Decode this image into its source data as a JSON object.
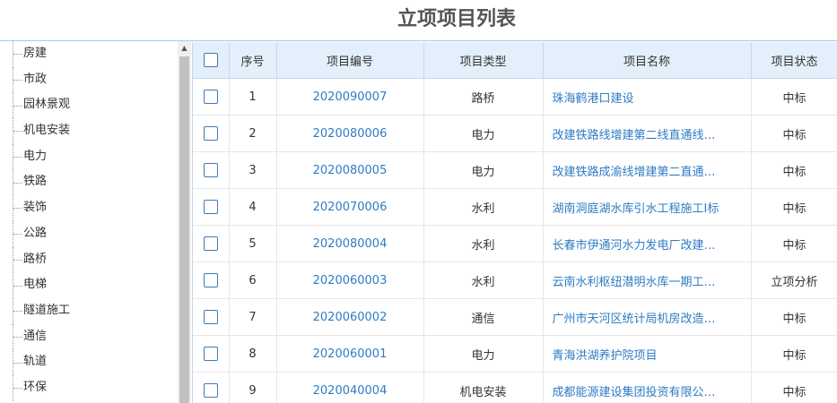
{
  "header": {
    "title": "立项项目列表"
  },
  "sidebar": {
    "items": [
      {
        "label": "房建"
      },
      {
        "label": "市政"
      },
      {
        "label": "园林景观"
      },
      {
        "label": "机电安装"
      },
      {
        "label": "电力"
      },
      {
        "label": "铁路"
      },
      {
        "label": "装饰"
      },
      {
        "label": "公路"
      },
      {
        "label": "路桥"
      },
      {
        "label": "电梯"
      },
      {
        "label": "隧道施工"
      },
      {
        "label": "通信"
      },
      {
        "label": "轨道"
      },
      {
        "label": "环保"
      }
    ]
  },
  "table": {
    "headers": {
      "seq": "序号",
      "code": "项目编号",
      "type": "项目类型",
      "name": "项目名称",
      "status": "项目状态"
    },
    "rows": [
      {
        "seq": "1",
        "code": "2020090007",
        "type": "路桥",
        "name": "珠海鹤港口建设",
        "status": "中标"
      },
      {
        "seq": "2",
        "code": "2020080006",
        "type": "电力",
        "name": "改建铁路线增建第二线直通线…",
        "status": "中标"
      },
      {
        "seq": "3",
        "code": "2020080005",
        "type": "电力",
        "name": "改建铁路成渝线增建第二直通…",
        "status": "中标"
      },
      {
        "seq": "4",
        "code": "2020070006",
        "type": "水利",
        "name": "湖南洞庭湖水库引水工程施工I标",
        "status": "中标"
      },
      {
        "seq": "5",
        "code": "2020080004",
        "type": "水利",
        "name": "长春市伊通河水力发电厂改建…",
        "status": "中标"
      },
      {
        "seq": "6",
        "code": "2020060003",
        "type": "水利",
        "name": "云南水利枢纽潜明水库一期工…",
        "status": "立项分析"
      },
      {
        "seq": "7",
        "code": "2020060002",
        "type": "通信",
        "name": "广州市天河区统计局机房改造…",
        "status": "中标"
      },
      {
        "seq": "8",
        "code": "2020060001",
        "type": "电力",
        "name": "青海洪湖养护院项目",
        "status": "中标"
      },
      {
        "seq": "9",
        "code": "2020040004",
        "type": "机电安装",
        "name": "成都能源建设集团投资有限公…",
        "status": "中标"
      }
    ]
  },
  "colors": {
    "header_bg": "#e3effa",
    "link": "#2e7cc4",
    "checkbox_border": "#3d7ab8"
  }
}
